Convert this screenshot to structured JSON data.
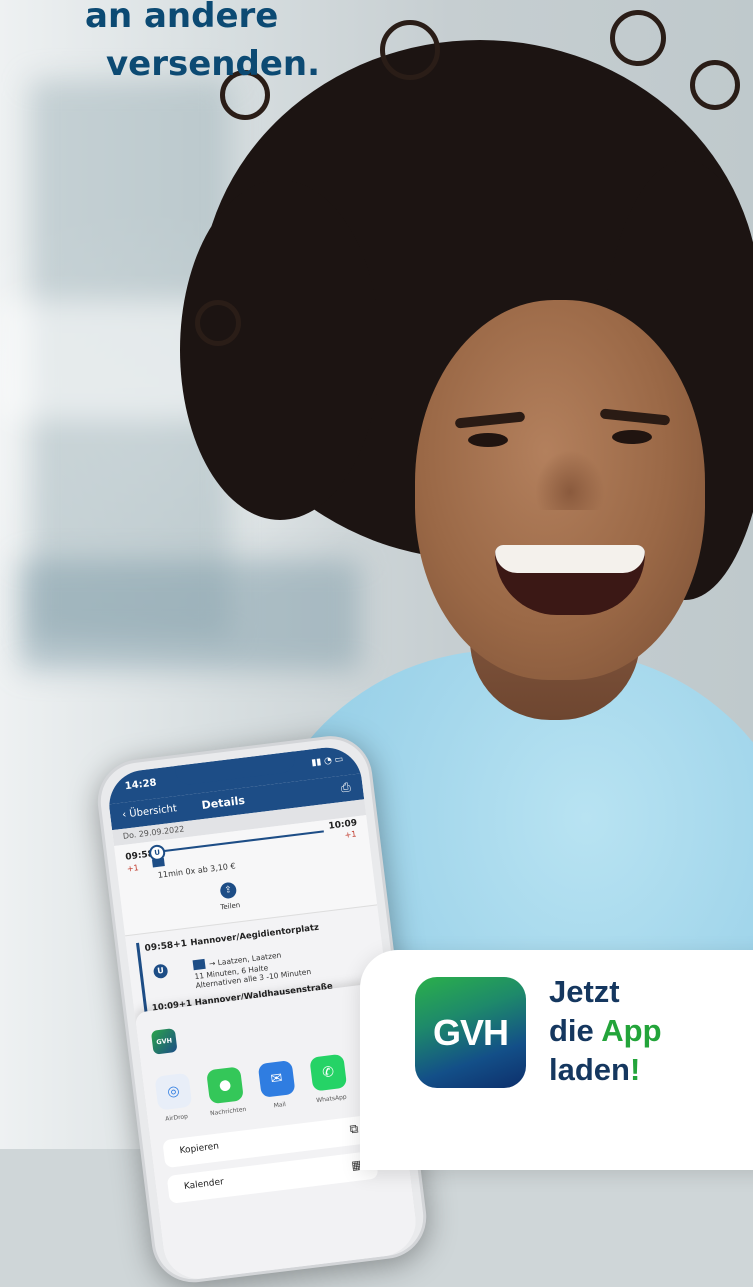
{
  "headline": {
    "line1": "an andere",
    "line2": "versenden."
  },
  "phone": {
    "status_time": "14:28",
    "nav": {
      "back": "Übersicht",
      "title": "Details"
    },
    "date": "Do. 29.09.2022",
    "trip": {
      "dep": "09:58",
      "dep_delay": "+1",
      "arr": "10:09",
      "arr_delay": "+1",
      "meta": "11min  0x  ab 3,10 €",
      "share_label": "Teilen"
    },
    "stop": {
      "time": "09:58+1",
      "name": "Hannover/Aegidientorplatz",
      "line_dir": "→ Laatzen, Laatzen",
      "duration": "11 Minuten, 6 Halte",
      "interval": "Alternativen alle 3 -10 Minuten",
      "next": "10:09+1  Hannover/Waldhausenstraße"
    },
    "share_sheet": {
      "app_label": "GVH",
      "targets": [
        "AirDrop",
        "Nachrichten",
        "Mail",
        "WhatsApp"
      ],
      "actions": [
        "Kopieren",
        "Kalender"
      ]
    }
  },
  "promo": {
    "logo_text": "GVH",
    "line1": "Jetzt",
    "line2_a": "die ",
    "line2_b": "App",
    "line3_a": "laden",
    "line3_b": "!"
  },
  "colors": {
    "brand_blue": "#15375f",
    "brand_green": "#23a43a",
    "headline": "#0c4a73"
  }
}
